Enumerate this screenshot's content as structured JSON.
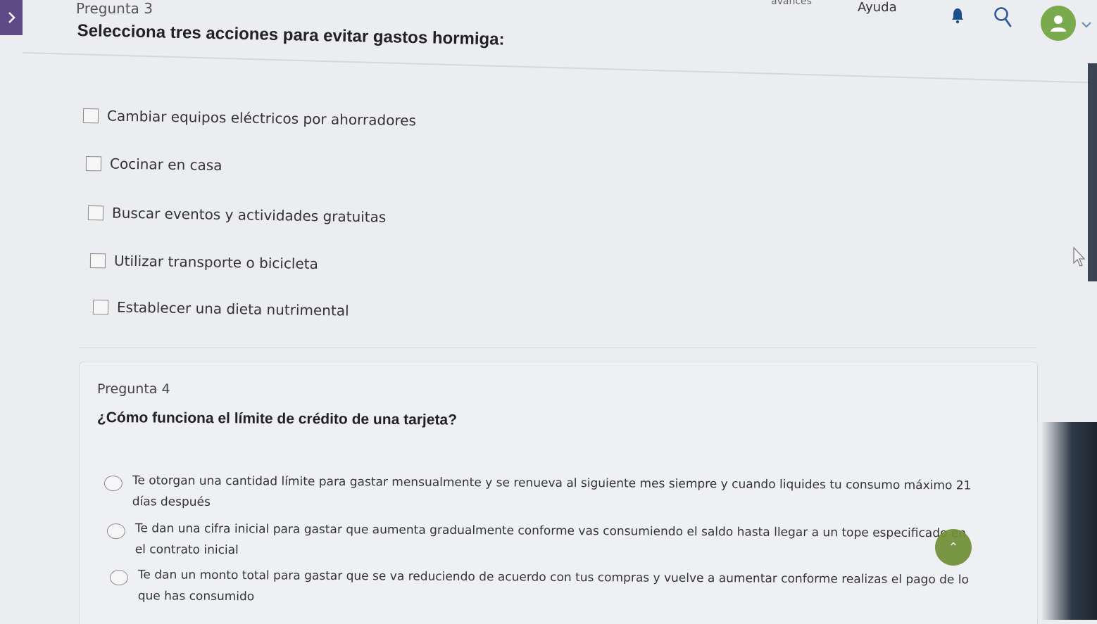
{
  "header": {
    "question_label": "Pregunta 3",
    "avances_label": "avances",
    "help_label": "Ayuda",
    "icons": [
      "chevron-right-icon",
      "bell-icon",
      "search-icon",
      "user-avatar",
      "chevron-down-icon"
    ],
    "avatar_color": "#7aaa4e",
    "sidebar_color": "#5d4a86"
  },
  "question3": {
    "title": "Selecciona tres acciones para evitar gastos hormiga:",
    "options": [
      "Cambiar equipos eléctricos por ahorradores",
      "Cocinar en casa",
      "Buscar eventos y actividades gratuitas",
      "Utilizar transporte o bicicleta",
      "Establecer una dieta nutrimental"
    ]
  },
  "question4": {
    "label": "Pregunta 4",
    "title": "¿Cómo funciona el límite de crédito de una tarjeta?",
    "options": [
      "Te otorgan una cantidad límite para gastar mensualmente y se renueva al siguiente mes siempre y cuando liquides tu consumo máximo 21 días después",
      "Te dan una cifra inicial para gastar que aumenta gradualmente conforme vas consumiendo el saldo hasta llegar a un tope especificado en el contrato inicial",
      "Te dan un monto total para gastar que se va reduciendo de acuerdo con tus compras y vuelve a aumentar conforme realizas el pago de lo que has consumido"
    ]
  },
  "scroll_top": {
    "icon": "double-chevron-up-icon",
    "glyph": "⌃",
    "color": "#6f8f36"
  }
}
